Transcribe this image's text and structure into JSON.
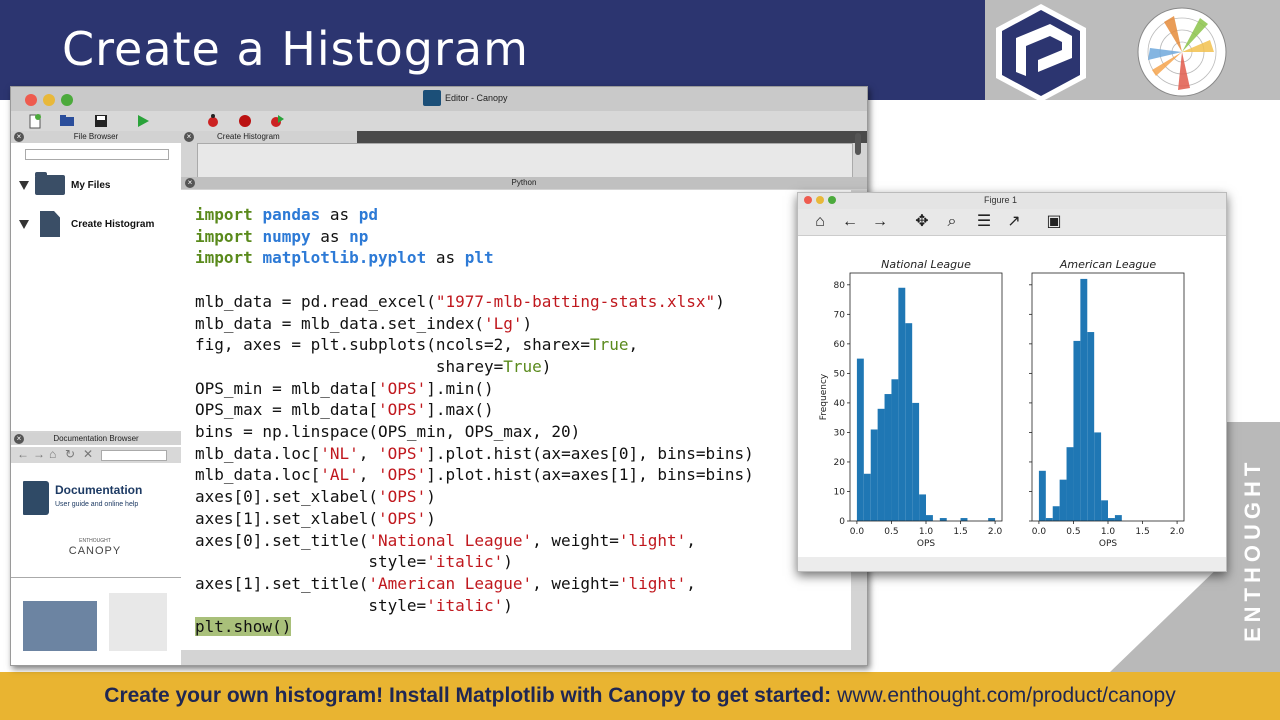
{
  "slide": {
    "title": "Create a Histogram",
    "footer_bold": "Create your own histogram! Install Matplotlib with Canopy to get started:",
    "footer_url": "www.enthought.com/product/canopy",
    "side_brand": "ENTHOUGHT"
  },
  "colors": {
    "header_navy": "#2c3570",
    "footer_gold": "#e9b431",
    "bar_blue": "#1f77b4",
    "keyword_green": "#5a8a1c",
    "module_blue": "#2d7ad6",
    "string_red": "#c0181e"
  },
  "editor": {
    "window_title": "Editor - Canopy",
    "file_browser_label": "File Browser",
    "tree": [
      {
        "label": "My Files",
        "icon": "folder-icon"
      },
      {
        "label": "Create Histogram",
        "icon": "document-icon"
      }
    ],
    "doc_browser_label": "Documentation Browser",
    "doc_title": "Documentation",
    "doc_subtitle": "User guide and online help",
    "canopy_small": "ENTHOUGHT",
    "canopy_big": "CANOPY",
    "file_tab": "Create Histogram",
    "python_panel_label": "Python",
    "code_lines": [
      "import pandas as pd",
      "import numpy as np",
      "import matplotlib.pyplot as plt",
      "",
      "mlb_data = pd.read_excel(\"1977-mlb-batting-stats.xlsx\")",
      "mlb_data = mlb_data.set_index('Lg')",
      "fig, axes = plt.subplots(ncols=2, sharex=True,",
      "                         sharey=True)",
      "OPS_min = mlb_data['OPS'].min()",
      "OPS_max = mlb_data['OPS'].max()",
      "bins = np.linspace(OPS_min, OPS_max, 20)",
      "mlb_data.loc['NL', 'OPS'].plot.hist(ax=axes[0], bins=bins)",
      "mlb_data.loc['AL', 'OPS'].plot.hist(ax=axes[1], bins=bins)",
      "axes[0].set_xlabel('OPS')",
      "axes[1].set_xlabel('OPS')",
      "axes[0].set_title('National League', weight='light',",
      "                  style='italic')",
      "axes[1].set_title('American League', weight='light',",
      "                  style='italic')",
      "plt.show()"
    ]
  },
  "figure": {
    "window_title": "Figure 1",
    "toolbar_icons": [
      "home-icon",
      "back-arrow-icon",
      "forward-arrow-icon",
      "pan-icon",
      "zoom-icon",
      "subplots-config-icon",
      "edit-axes-icon",
      "save-icon"
    ]
  },
  "chart_data": [
    {
      "type": "bar",
      "title": "National League",
      "xlabel": "OPS",
      "ylabel": "Frequency",
      "bin_edges": [
        0.0,
        0.1,
        0.2,
        0.3,
        0.4,
        0.5,
        0.6,
        0.7,
        0.8,
        0.9,
        1.0,
        1.1,
        1.2,
        1.3,
        1.4,
        1.5,
        1.6,
        1.7,
        1.8,
        1.9,
        2.0
      ],
      "values": [
        55,
        16,
        31,
        38,
        43,
        48,
        79,
        67,
        40,
        9,
        2,
        0,
        1,
        0,
        0,
        1,
        0,
        0,
        0,
        1
      ],
      "xlim": [
        -0.1,
        2.1
      ],
      "ylim": [
        0,
        84
      ],
      "xticks": [
        "0.0",
        "0.5",
        "1.0",
        "1.5",
        "2.0"
      ],
      "yticks": [
        "0",
        "10",
        "20",
        "30",
        "40",
        "50",
        "60",
        "70",
        "80"
      ],
      "grid": false
    },
    {
      "type": "bar",
      "title": "American League",
      "xlabel": "OPS",
      "ylabel": "",
      "bin_edges": [
        0.0,
        0.1,
        0.2,
        0.3,
        0.4,
        0.5,
        0.6,
        0.7,
        0.8,
        0.9,
        1.0,
        1.1,
        1.2,
        1.3,
        1.4,
        1.5,
        1.6,
        1.7,
        1.8,
        1.9,
        2.0
      ],
      "values": [
        17,
        1,
        5,
        14,
        25,
        61,
        82,
        64,
        30,
        7,
        1,
        2,
        0,
        0,
        0,
        0,
        0,
        0,
        0,
        0
      ],
      "xlim": [
        -0.1,
        2.1
      ],
      "ylim": [
        0,
        84
      ],
      "xticks": [
        "0.0",
        "0.5",
        "1.0",
        "1.5",
        "2.0"
      ],
      "yticks": [],
      "grid": false
    }
  ]
}
